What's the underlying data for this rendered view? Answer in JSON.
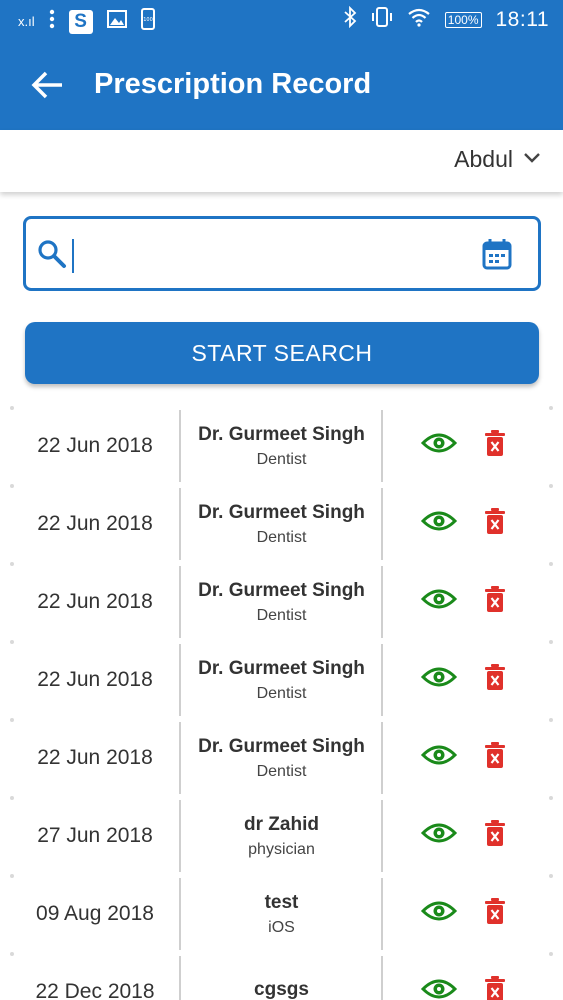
{
  "status_bar": {
    "signal": "x.ıl",
    "time": "18:11",
    "battery": "100%",
    "app_badge": "S",
    "notif_badge": "100"
  },
  "toolbar": {
    "title": "Prescription Record"
  },
  "patient": {
    "selected": "Abdul"
  },
  "search": {
    "value": "",
    "placeholder": "",
    "button_label": "START SEARCH"
  },
  "colors": {
    "primary": "#1f74c4",
    "view_icon": "#1a8a1a",
    "delete_icon": "#e0312b"
  },
  "records": [
    {
      "date": "22 Jun 2018",
      "doctor": "Dr. Gurmeet Singh",
      "specialty": "Dentist"
    },
    {
      "date": "22 Jun 2018",
      "doctor": "Dr. Gurmeet Singh",
      "specialty": "Dentist"
    },
    {
      "date": "22 Jun 2018",
      "doctor": "Dr. Gurmeet Singh",
      "specialty": "Dentist"
    },
    {
      "date": "22 Jun 2018",
      "doctor": "Dr. Gurmeet Singh",
      "specialty": "Dentist"
    },
    {
      "date": "22 Jun 2018",
      "doctor": "Dr. Gurmeet Singh",
      "specialty": "Dentist"
    },
    {
      "date": "27 Jun 2018",
      "doctor": "dr Zahid",
      "specialty": "physician"
    },
    {
      "date": "09 Aug 2018",
      "doctor": "test",
      "specialty": "iOS"
    },
    {
      "date": "22 Dec 2018",
      "doctor": "cgsgs",
      "specialty": ""
    }
  ]
}
